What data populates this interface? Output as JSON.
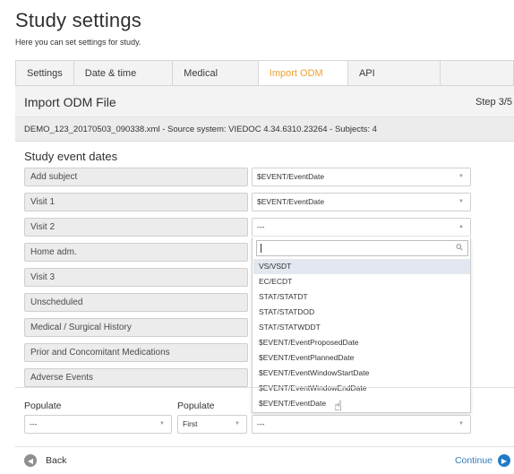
{
  "page": {
    "title": "Study settings",
    "subtitle": "Here you can set settings for study."
  },
  "tabs": [
    {
      "label": "Settings"
    },
    {
      "label": "Date & time format"
    },
    {
      "label": "Medical Coding"
    },
    {
      "label": "Import ODM File"
    },
    {
      "label": "API configuration"
    }
  ],
  "panel": {
    "title": "Import ODM File",
    "step": "Step 3/5",
    "source_info": "DEMO_123_20170503_090338.xml - Source system: VIEDOC 4.34.6310.23264 - Subjects: 4",
    "section_title": "Study event dates"
  },
  "events": [
    {
      "label": "Add subject",
      "value": "$EVENT/EventDate"
    },
    {
      "label": "Visit 1",
      "value": "$EVENT/EventDate"
    },
    {
      "label": "Visit 2",
      "value": "---"
    },
    {
      "label": "Home adm."
    },
    {
      "label": "Visit 3"
    },
    {
      "label": "Unscheduled"
    },
    {
      "label": "Medical / Surgical History"
    },
    {
      "label": "Prior and Concomitant Medications"
    },
    {
      "label": "Adverse Events"
    }
  ],
  "dropdown": {
    "search_value": "",
    "options": [
      "VS/VSDT",
      "EC/ECDT",
      "STAT/STATDT",
      "STAT/STATDOD",
      "STAT/STATWDDT",
      "$EVENT/EventProposedDate",
      "$EVENT/EventPlannedDate",
      "$EVENT/EventWindowStartDate",
      "$EVENT/EventWindowEndDate",
      "$EVENT/EventDate"
    ],
    "highlighted_index": 0
  },
  "populate": {
    "label_1": "Populate",
    "label_2": "Populate",
    "select_1": "---",
    "select_2": "First",
    "select_3": "---"
  },
  "footer": {
    "back_label": "Back",
    "continue_label": "Continue"
  },
  "colors": {
    "active_tab": "#f0a030",
    "continue": "#2f7fc1",
    "highlight": "#e2e7f0"
  }
}
